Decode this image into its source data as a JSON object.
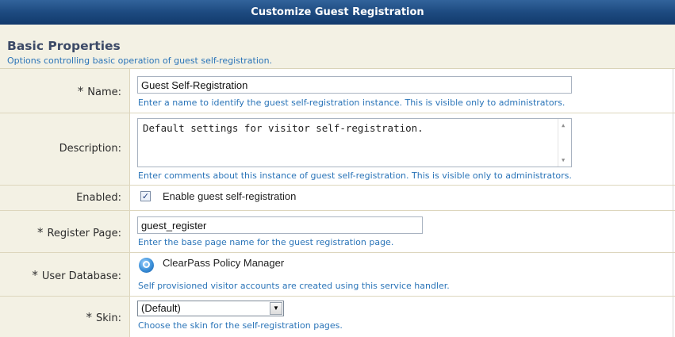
{
  "title": "Customize Guest Registration",
  "section": {
    "heading": "Basic Properties",
    "description": "Options controlling basic operation of guest self-registration."
  },
  "fields": {
    "name": {
      "required": "*",
      "label": "Name:",
      "value": "Guest Self-Registration",
      "hint": "Enter a name to identify the guest self-registration instance. This is visible only to administrators."
    },
    "description": {
      "label": "Description:",
      "value": "Default settings for visitor self-registration.",
      "hint": "Enter comments about this instance of guest self-registration. This is visible only to administrators."
    },
    "enabled": {
      "label": "Enabled:",
      "checked": true,
      "checkbox_label": "Enable guest self-registration"
    },
    "register_page": {
      "required": "*",
      "label": "Register Page:",
      "value": "guest_register",
      "hint": "Enter the base page name for the guest registration page."
    },
    "user_database": {
      "required": "*",
      "label": "User Database:",
      "icon": "clearpass-handler-icon",
      "handler_name": "ClearPass Policy Manager",
      "hint": "Self provisioned visitor accounts are created using this service handler."
    },
    "skin": {
      "required": "*",
      "label": "Skin:",
      "selected": "(Default)",
      "hint": "Choose the skin for the self-registration pages."
    }
  },
  "colors": {
    "title_bar": "#1d4a80",
    "label_column_bg": "#f3f1e4",
    "hint_text": "#2a74b8"
  }
}
